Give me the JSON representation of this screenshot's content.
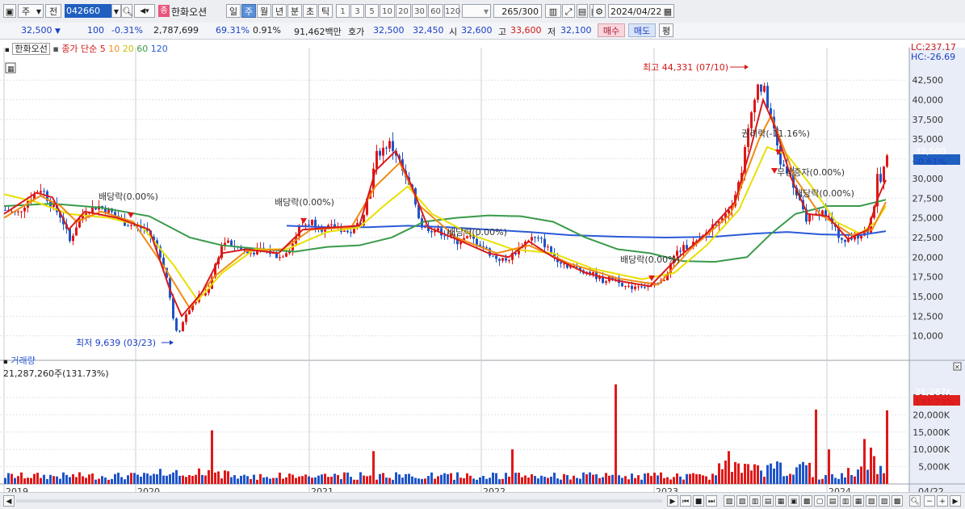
{
  "toolbar": {
    "period_main": "주",
    "prev": "전",
    "stock_code": "042660",
    "stock_badge": "종",
    "stock_name": "한화오션",
    "periods": [
      "일",
      "주",
      "월",
      "년",
      "분",
      "초",
      "틱"
    ],
    "selected_period": "주",
    "intervals": [
      "1",
      "3",
      "5",
      "10",
      "20",
      "30",
      "60",
      "120"
    ],
    "count_value": "265",
    "count_max": "/300",
    "date": "2024/04/22"
  },
  "info": {
    "price": "32,500",
    "change": "100",
    "change_pct": "-0.31%",
    "volume": "2,787,699",
    "vol_ratio": "69.31%",
    "turnover": "0.91%",
    "amount": "91,462백만",
    "ask_label": "호가",
    "ask": "32,500",
    "bid": "32,450",
    "open_label": "시",
    "open": "32,600",
    "high_label": "고",
    "high": "33,600",
    "low_label": "저",
    "low": "32,100",
    "buy": "매수",
    "sell": "매도",
    "avg": "평"
  },
  "legend": {
    "name": "한화오선",
    "label": "종가 단순",
    "ma": [
      {
        "period": "5",
        "color": "#d81b1b"
      },
      {
        "period": "10",
        "color": "#f08c14"
      },
      {
        "period": "20",
        "color": "#e8e000"
      },
      {
        "period": "60",
        "color": "#3a9a4a"
      },
      {
        "period": "120",
        "color": "#2a5ad8"
      }
    ]
  },
  "right_tags": {
    "lc": "LC:237.17",
    "hc": "HC:-26.69",
    "price_tag": "32,500",
    "pct_tag": "-0.61%",
    "vol_tag": "21,287K",
    "vol_pct_tag": "131.73%"
  },
  "volume_legend": {
    "title": "거래량",
    "value": "21,287,260주(131.73%)"
  },
  "chart_data": {
    "type": "candlestick",
    "price_axis": {
      "ticks": [
        10000,
        12500,
        15000,
        17500,
        20000,
        22500,
        25000,
        27500,
        30000,
        32500,
        35000,
        37500,
        40000,
        42500
      ],
      "labels": [
        "10,000",
        "12,500",
        "15,000",
        "17,500",
        "20,000",
        "22,500",
        "25,000",
        "27,500",
        "30,000",
        "32,500",
        "35,000",
        "37,500",
        "40,000",
        "42,500"
      ],
      "range": [
        7500,
        45500
      ]
    },
    "volume_axis": {
      "ticks": [
        5000,
        10000,
        15000,
        20000,
        25000
      ],
      "labels": [
        "5,000K",
        "10,000K",
        "15,000K",
        "20,000K",
        "25,000K"
      ],
      "range": [
        0,
        32000
      ]
    },
    "x_labels": [
      "2019",
      "2020",
      "2021",
      "2022",
      "2023",
      "2024",
      "04/22"
    ],
    "annotations": {
      "high": "최고 44,331 (07/10)",
      "low": "최저 9,639 (03/23)",
      "div1": "배당락(0.00%)",
      "div2": "배당락(0.00%)",
      "div3": "배당락(0.00%)",
      "div4": "배당락(0.00%)",
      "div5": "배당락(0.00%)",
      "rights": "권리락(-11.16%)",
      "bonus": "무상증자(0.00%)"
    },
    "close_path": [
      [
        0,
        26000
      ],
      [
        15,
        25500
      ],
      [
        30,
        27500
      ],
      [
        45,
        28800
      ],
      [
        55,
        27000
      ],
      [
        70,
        25000
      ],
      [
        80,
        22000
      ],
      [
        90,
        24500
      ],
      [
        100,
        26000
      ],
      [
        115,
        26500
      ],
      [
        130,
        25800
      ],
      [
        145,
        24500
      ],
      [
        160,
        24000
      ],
      [
        175,
        23500
      ],
      [
        190,
        21000
      ],
      [
        200,
        17500
      ],
      [
        210,
        11000
      ],
      [
        215,
        10500
      ],
      [
        225,
        13000
      ],
      [
        240,
        15000
      ],
      [
        250,
        15500
      ],
      [
        260,
        19000
      ],
      [
        270,
        22000
      ],
      [
        285,
        21500
      ],
      [
        300,
        20500
      ],
      [
        320,
        21000
      ],
      [
        340,
        20000
      ],
      [
        355,
        21500
      ],
      [
        365,
        24000
      ],
      [
        380,
        24500
      ],
      [
        395,
        23500
      ],
      [
        410,
        24000
      ],
      [
        425,
        23000
      ],
      [
        440,
        24500
      ],
      [
        450,
        28000
      ],
      [
        460,
        33000
      ],
      [
        475,
        34500
      ],
      [
        485,
        33000
      ],
      [
        495,
        30000
      ],
      [
        505,
        28000
      ],
      [
        515,
        24000
      ],
      [
        530,
        23500
      ],
      [
        545,
        23000
      ],
      [
        560,
        22000
      ],
      [
        575,
        22500
      ],
      [
        590,
        21500
      ],
      [
        605,
        20000
      ],
      [
        620,
        19500
      ],
      [
        635,
        21000
      ],
      [
        650,
        22500
      ],
      [
        665,
        22000
      ],
      [
        680,
        20000
      ],
      [
        695,
        19000
      ],
      [
        710,
        18500
      ],
      [
        725,
        18000
      ],
      [
        740,
        17000
      ],
      [
        755,
        17500
      ],
      [
        770,
        16000
      ],
      [
        785,
        16500
      ],
      [
        800,
        16200
      ],
      [
        815,
        17000
      ],
      [
        830,
        20500
      ],
      [
        845,
        21500
      ],
      [
        860,
        22000
      ],
      [
        875,
        24000
      ],
      [
        890,
        25500
      ],
      [
        900,
        27000
      ],
      [
        910,
        30000
      ],
      [
        920,
        36000
      ],
      [
        930,
        42000
      ],
      [
        940,
        41000
      ],
      [
        950,
        37000
      ],
      [
        960,
        32000
      ],
      [
        970,
        31000
      ],
      [
        980,
        28000
      ],
      [
        990,
        25000
      ],
      [
        1000,
        25000
      ],
      [
        1010,
        26000
      ],
      [
        1020,
        25000
      ],
      [
        1030,
        23000
      ],
      [
        1040,
        22000
      ],
      [
        1050,
        22500
      ],
      [
        1060,
        23000
      ],
      [
        1068,
        23500
      ],
      [
        1075,
        26000
      ],
      [
        1080,
        30000
      ],
      [
        1085,
        29500
      ],
      [
        1090,
        32500
      ]
    ],
    "ma5": [
      [
        0,
        25500
      ],
      [
        40,
        28200
      ],
      [
        60,
        27600
      ],
      [
        80,
        23500
      ],
      [
        100,
        25800
      ],
      [
        140,
        25000
      ],
      [
        180,
        23500
      ],
      [
        205,
        16000
      ],
      [
        220,
        12500
      ],
      [
        245,
        15500
      ],
      [
        270,
        20500
      ],
      [
        300,
        21000
      ],
      [
        340,
        20500
      ],
      [
        370,
        23500
      ],
      [
        410,
        23800
      ],
      [
        440,
        24000
      ],
      [
        460,
        31000
      ],
      [
        485,
        33500
      ],
      [
        505,
        29000
      ],
      [
        525,
        23800
      ],
      [
        560,
        22300
      ],
      [
        600,
        20500
      ],
      [
        625,
        20000
      ],
      [
        650,
        22000
      ],
      [
        680,
        20000
      ],
      [
        720,
        18000
      ],
      [
        760,
        17000
      ],
      [
        800,
        16300
      ],
      [
        830,
        19500
      ],
      [
        870,
        23000
      ],
      [
        905,
        27000
      ],
      [
        925,
        34000
      ],
      [
        940,
        40000
      ],
      [
        955,
        36500
      ],
      [
        975,
        30000
      ],
      [
        995,
        25500
      ],
      [
        1020,
        25200
      ],
      [
        1045,
        22300
      ],
      [
        1070,
        23500
      ],
      [
        1082,
        27500
      ],
      [
        1092,
        29800
      ]
    ],
    "ma10": [
      [
        0,
        25000
      ],
      [
        45,
        27800
      ],
      [
        70,
        26500
      ],
      [
        90,
        24500
      ],
      [
        120,
        25800
      ],
      [
        160,
        24500
      ],
      [
        200,
        18500
      ],
      [
        230,
        13500
      ],
      [
        260,
        17500
      ],
      [
        300,
        20800
      ],
      [
        345,
        21000
      ],
      [
        380,
        23500
      ],
      [
        430,
        23800
      ],
      [
        460,
        29000
      ],
      [
        490,
        32000
      ],
      [
        515,
        26500
      ],
      [
        560,
        22500
      ],
      [
        610,
        20500
      ],
      [
        650,
        21500
      ],
      [
        700,
        19200
      ],
      [
        760,
        17300
      ],
      [
        810,
        16500
      ],
      [
        850,
        21000
      ],
      [
        900,
        25500
      ],
      [
        935,
        35000
      ],
      [
        950,
        38000
      ],
      [
        980,
        30000
      ],
      [
        1010,
        25500
      ],
      [
        1050,
        22800
      ],
      [
        1075,
        23500
      ],
      [
        1092,
        27000
      ]
    ],
    "ma20": [
      [
        0,
        28000
      ],
      [
        40,
        27000
      ],
      [
        80,
        25500
      ],
      [
        130,
        25000
      ],
      [
        170,
        24000
      ],
      [
        210,
        19000
      ],
      [
        240,
        14500
      ],
      [
        270,
        18000
      ],
      [
        310,
        21000
      ],
      [
        350,
        21000
      ],
      [
        400,
        23200
      ],
      [
        440,
        23800
      ],
      [
        470,
        26500
      ],
      [
        500,
        29000
      ],
      [
        530,
        25500
      ],
      [
        580,
        22800
      ],
      [
        630,
        21000
      ],
      [
        680,
        20500
      ],
      [
        730,
        18500
      ],
      [
        790,
        17200
      ],
      [
        830,
        18000
      ],
      [
        870,
        21500
      ],
      [
        910,
        26000
      ],
      [
        945,
        34000
      ],
      [
        970,
        33000
      ],
      [
        1000,
        29000
      ],
      [
        1030,
        24500
      ],
      [
        1060,
        23000
      ],
      [
        1080,
        24500
      ],
      [
        1092,
        26500
      ]
    ],
    "ma60": [
      [
        0,
        26500
      ],
      [
        60,
        26800
      ],
      [
        120,
        26300
      ],
      [
        180,
        25200
      ],
      [
        230,
        22500
      ],
      [
        270,
        21500
      ],
      [
        320,
        21000
      ],
      [
        360,
        20700
      ],
      [
        400,
        21300
      ],
      [
        440,
        21500
      ],
      [
        480,
        22500
      ],
      [
        520,
        24500
      ],
      [
        560,
        25000
      ],
      [
        600,
        25300
      ],
      [
        640,
        25200
      ],
      [
        680,
        24500
      ],
      [
        720,
        22500
      ],
      [
        760,
        21000
      ],
      [
        800,
        20500
      ],
      [
        840,
        19500
      ],
      [
        880,
        19400
      ],
      [
        920,
        20000
      ],
      [
        950,
        23000
      ],
      [
        980,
        25500
      ],
      [
        1020,
        26500
      ],
      [
        1060,
        26500
      ],
      [
        1092,
        27300
      ]
    ],
    "ma120": [
      [
        350,
        24000
      ],
      [
        400,
        23800
      ],
      [
        450,
        23800
      ],
      [
        500,
        24000
      ],
      [
        550,
        23800
      ],
      [
        600,
        23500
      ],
      [
        650,
        23200
      ],
      [
        700,
        22800
      ],
      [
        760,
        22600
      ],
      [
        820,
        22500
      ],
      [
        880,
        22600
      ],
      [
        930,
        23000
      ],
      [
        970,
        23200
      ],
      [
        1010,
        22900
      ],
      [
        1060,
        22800
      ],
      [
        1092,
        23300
      ]
    ],
    "volume_spikes": [
      [
        257,
        15500
      ],
      [
        455,
        9500
      ],
      [
        627,
        10000
      ],
      [
        755,
        28800
      ],
      [
        895,
        9500
      ],
      [
        910,
        18000
      ],
      [
        1005,
        21500
      ],
      [
        1020,
        10000
      ],
      [
        1065,
        13000
      ],
      [
        1073,
        10500
      ],
      [
        1082,
        14000
      ],
      [
        1092,
        21287
      ]
    ]
  }
}
